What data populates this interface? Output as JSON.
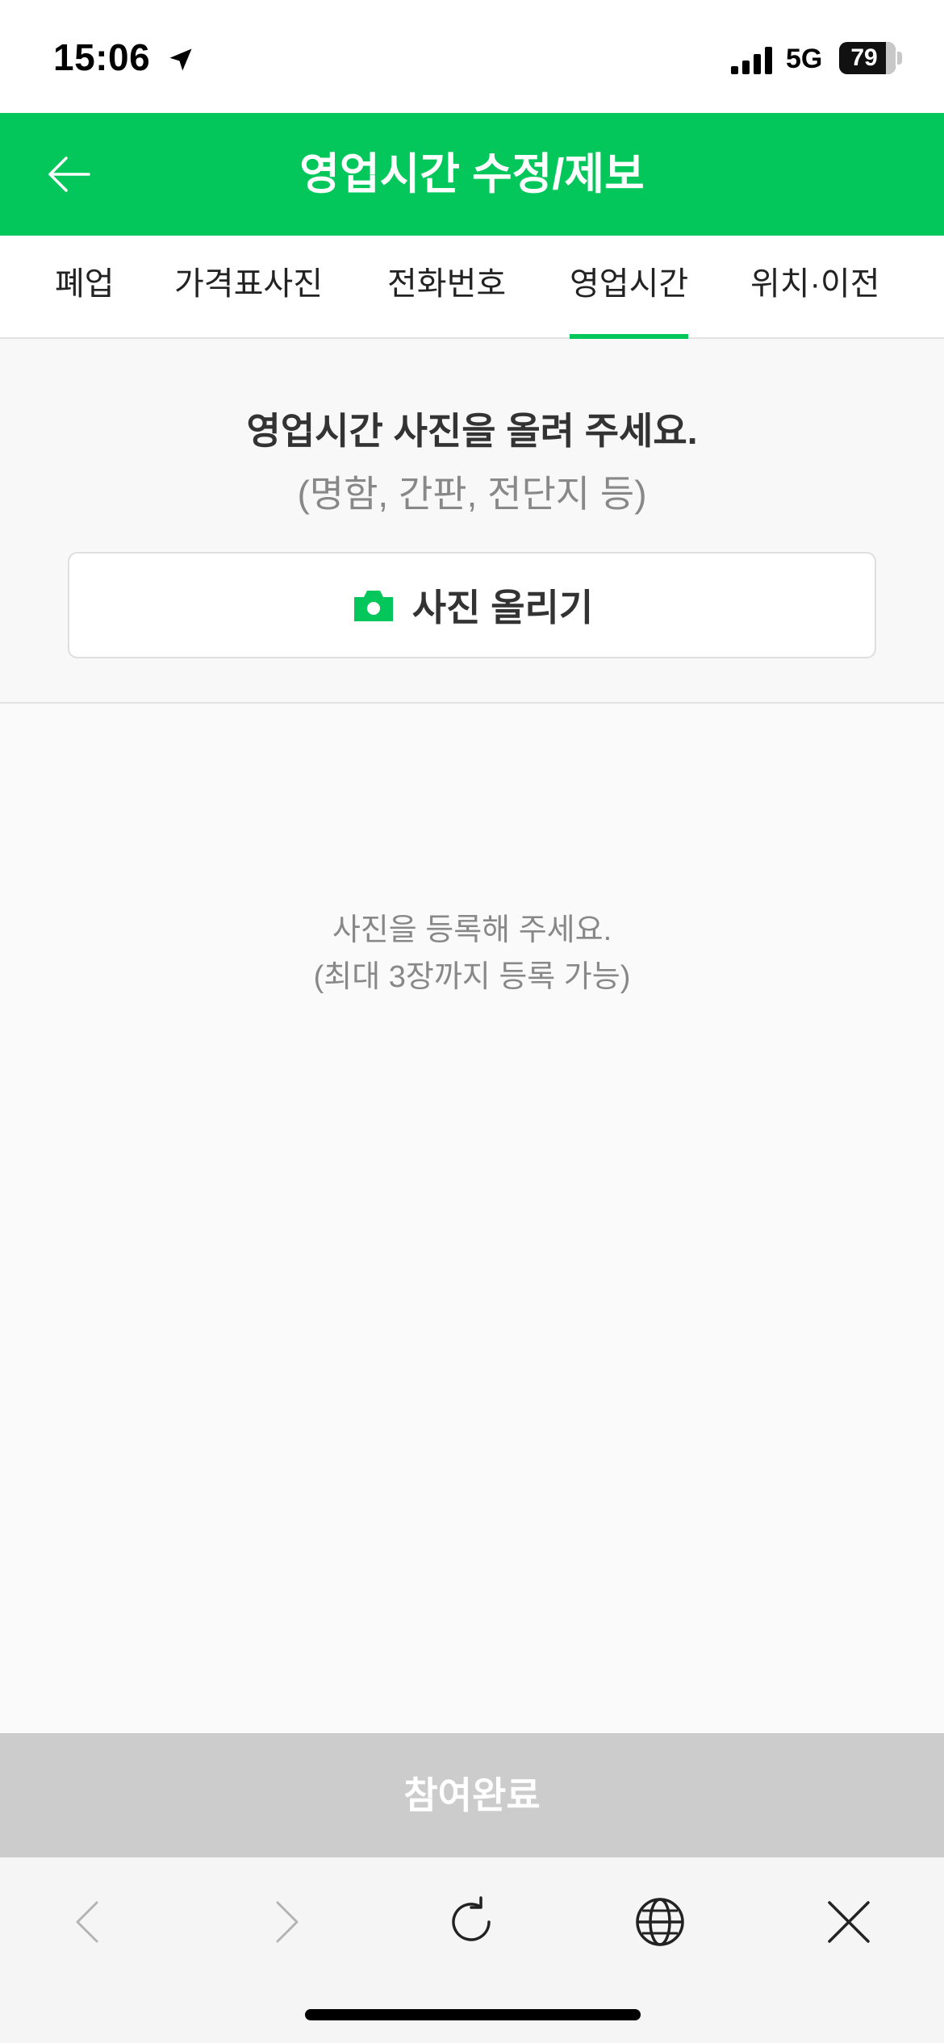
{
  "status_bar": {
    "time": "15:06",
    "network": "5G",
    "battery": "79"
  },
  "header": {
    "title": "영업시간 수정/제보",
    "back_icon": "arrow-left-icon"
  },
  "tabs": [
    {
      "label": "폐업",
      "active": false
    },
    {
      "label": "가격표사진",
      "active": false
    },
    {
      "label": "전화번호",
      "active": false
    },
    {
      "label": "영업시간",
      "active": true
    },
    {
      "label": "위치·이전",
      "active": false
    }
  ],
  "upload": {
    "heading": "영업시간 사진을 올려 주세요.",
    "subtext": "(명함, 간판, 전단지 등)",
    "button_label": "사진 올리기",
    "button_icon": "camera-icon"
  },
  "empty_state": {
    "line1": "사진을 등록해 주세요.",
    "line2": "(최대 3장까지 등록 가능)"
  },
  "submit": {
    "label": "참여완료"
  },
  "browser_toolbar": {
    "icons": [
      "chevron-left-icon",
      "chevron-right-icon",
      "reload-icon",
      "globe-icon",
      "close-icon"
    ]
  },
  "colors": {
    "brand": "#03c75a",
    "submit_disabled": "#cccccc",
    "muted_text": "#888888"
  }
}
